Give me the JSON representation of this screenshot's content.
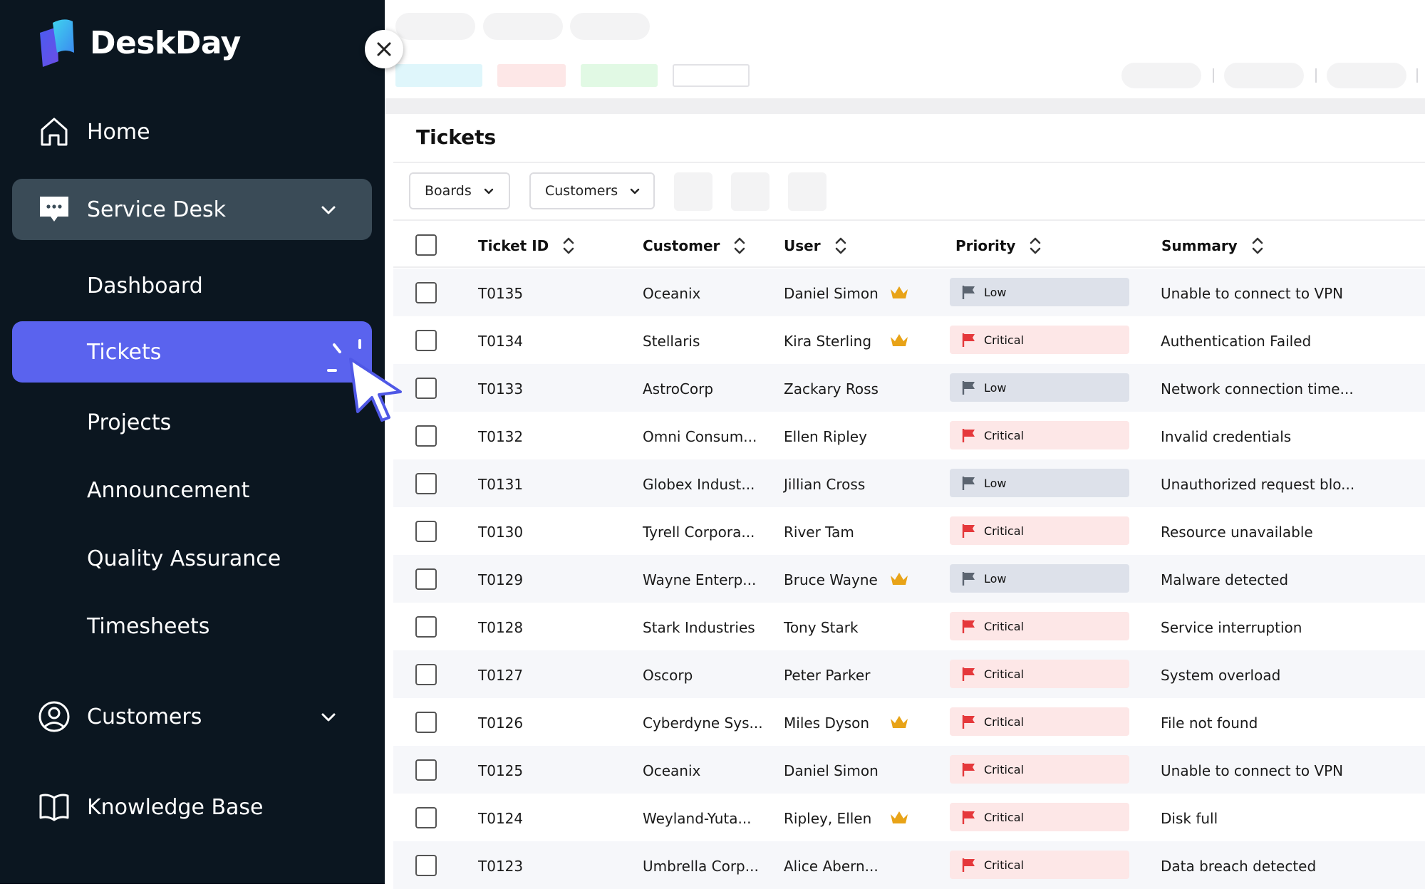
{
  "app": {
    "brand": "DeskDay"
  },
  "sidebar": {
    "home": "Home",
    "service_desk": "Service Desk",
    "sub_items": {
      "dashboard": "Dashboard",
      "tickets": "Tickets",
      "projects": "Projects",
      "announcement": "Announcement",
      "quality_assurance": "Quality Assurance",
      "timesheets": "Timesheets"
    },
    "customers": "Customers",
    "knowledge_base": "Knowledge Base"
  },
  "main": {
    "title": "Tickets",
    "filters": {
      "boards": "Boards",
      "customers": "Customers"
    },
    "columns": {
      "ticket_id": "Ticket ID",
      "customer": "Customer",
      "user": "User",
      "priority": "Priority",
      "summary": "Summary"
    },
    "rows": [
      {
        "id": "T0135",
        "customer": "Oceanix",
        "user": "Daniel Simon",
        "vip": true,
        "priority": "Low",
        "summary": "Unable to connect to VPN"
      },
      {
        "id": "T0134",
        "customer": "Stellaris",
        "user": "Kira Sterling",
        "vip": true,
        "priority": "Critical",
        "summary": "Authentication Failed"
      },
      {
        "id": "T0133",
        "customer": "AstroCorp",
        "user": "Zackary Ross",
        "vip": false,
        "priority": "Low",
        "summary": "Network connection time..."
      },
      {
        "id": "T0132",
        "customer": "Omni Consum...",
        "user": "Ellen Ripley",
        "vip": false,
        "priority": "Critical",
        "summary": "Invalid credentials"
      },
      {
        "id": "T0131",
        "customer": "Globex Indust...",
        "user": "Jillian Cross",
        "vip": false,
        "priority": "Low",
        "summary": "Unauthorized request blo..."
      },
      {
        "id": "T0130",
        "customer": "Tyrell Corpora...",
        "user": "River Tam",
        "vip": false,
        "priority": "Critical",
        "summary": "Resource unavailable"
      },
      {
        "id": "T0129",
        "customer": "Wayne Enterp...",
        "user": "Bruce Wayne",
        "vip": true,
        "priority": "Low",
        "summary": "Malware detected"
      },
      {
        "id": "T0128",
        "customer": "Stark Industries",
        "user": "Tony Stark",
        "vip": false,
        "priority": "Critical",
        "summary": "Service interruption"
      },
      {
        "id": "T0127",
        "customer": "Oscorp",
        "user": "Peter Parker",
        "vip": false,
        "priority": "Critical",
        "summary": "System overload"
      },
      {
        "id": "T0126",
        "customer": "Cyberdyne Sys...",
        "user": "Miles Dyson",
        "vip": true,
        "priority": "Critical",
        "summary": "File not found"
      },
      {
        "id": "T0125",
        "customer": "Oceanix",
        "user": "Daniel Simon",
        "vip": false,
        "priority": "Critical",
        "summary": "Unable to connect to VPN"
      },
      {
        "id": "T0124",
        "customer": "Weyland-Yuta...",
        "user": "Ripley, Ellen",
        "vip": true,
        "priority": "Critical",
        "summary": "Disk full"
      },
      {
        "id": "T0123",
        "customer": "Umbrella Corp...",
        "user": "Alice Abern...",
        "vip": false,
        "priority": "Critical",
        "summary": "Data breach detected"
      }
    ]
  },
  "colors": {
    "sidebar_bg": "#0b1620",
    "active_item": "#5a63ee",
    "service_desk_bg": "#3a4b57",
    "low_bg": "#dde1ea",
    "critical_bg": "#fde7e7",
    "critical_flag": "#e5383b",
    "low_flag": "#5b6470",
    "crown": "#e8a317"
  },
  "icons": {
    "brand": "deskday-logo",
    "home": "home-icon",
    "service_desk": "chat-bubble-icon",
    "customers": "user-circle-icon",
    "knowledge_base": "book-icon",
    "close": "close-icon",
    "sort": "sort-icon",
    "flag": "flag-icon",
    "vip": "crown-icon",
    "cursor": "pointer-cursor-icon"
  }
}
